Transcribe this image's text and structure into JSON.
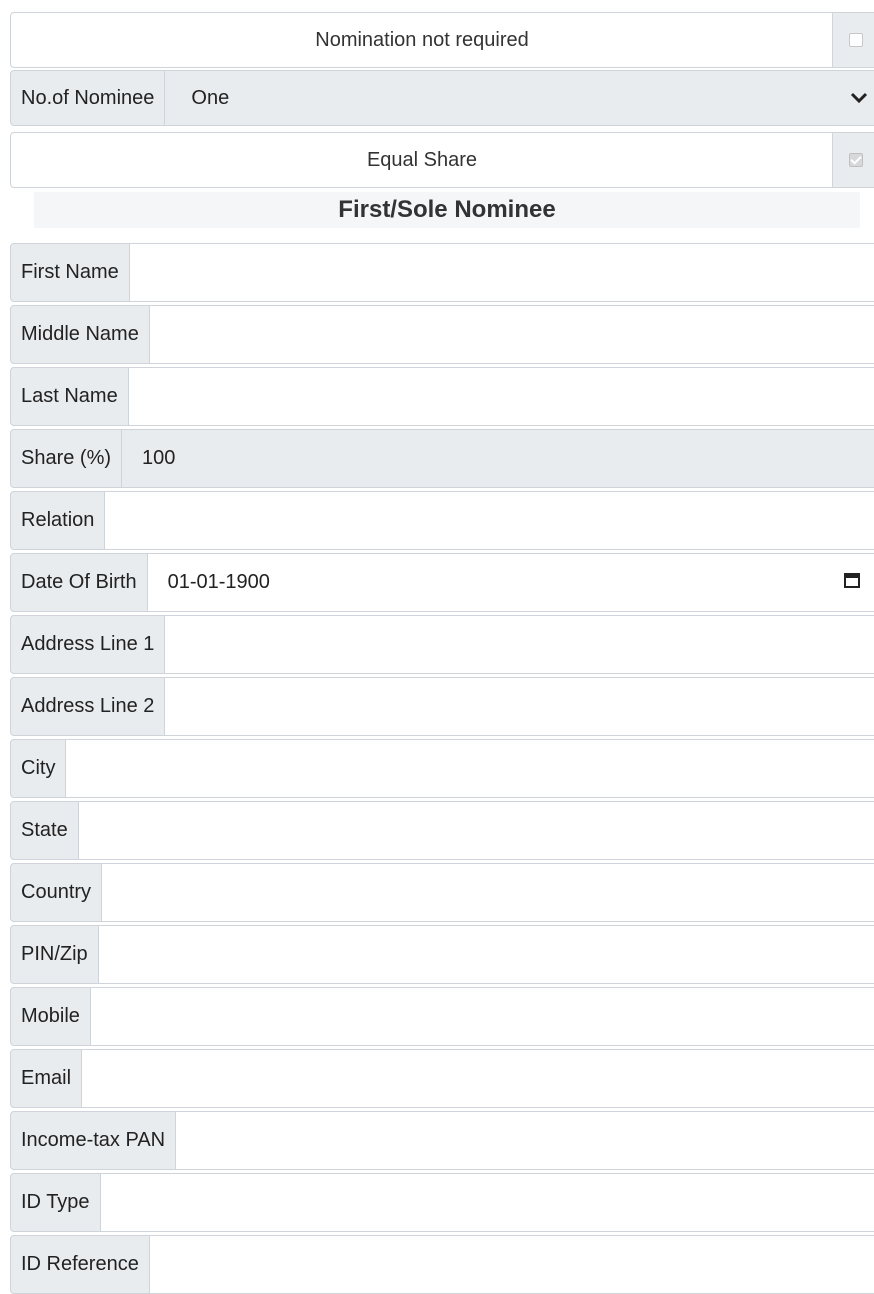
{
  "options": {
    "nomination_not_required": {
      "label": "Nomination not required",
      "checked": false
    },
    "equal_share": {
      "label": "Equal Share",
      "checked": true
    }
  },
  "nominee_count": {
    "label": "No.of Nominee",
    "value": "One"
  },
  "section_title": "First/Sole Nominee",
  "fields": {
    "first_name": {
      "label": "First Name",
      "value": ""
    },
    "middle_name": {
      "label": "Middle Name",
      "value": ""
    },
    "last_name": {
      "label": "Last Name",
      "value": ""
    },
    "share": {
      "label": "Share (%)",
      "value": "100"
    },
    "relation": {
      "label": "Relation",
      "value": ""
    },
    "dob": {
      "label": "Date Of Birth",
      "value": "01-01-1900"
    },
    "address1": {
      "label": "Address Line 1",
      "value": ""
    },
    "address2": {
      "label": "Address Line 2",
      "value": ""
    },
    "city": {
      "label": "City",
      "value": ""
    },
    "state": {
      "label": "State",
      "value": ""
    },
    "country": {
      "label": "Country",
      "value": ""
    },
    "pin": {
      "label": "PIN/Zip",
      "value": ""
    },
    "mobile": {
      "label": "Mobile",
      "value": ""
    },
    "email": {
      "label": "Email",
      "value": ""
    },
    "pan": {
      "label": "Income-tax PAN",
      "value": ""
    },
    "id_type": {
      "label": "ID Type",
      "value": ""
    },
    "id_reference": {
      "label": "ID Reference",
      "value": ""
    }
  },
  "icons": {
    "chevron": "chevron-down-icon",
    "calendar": "calendar-icon"
  }
}
